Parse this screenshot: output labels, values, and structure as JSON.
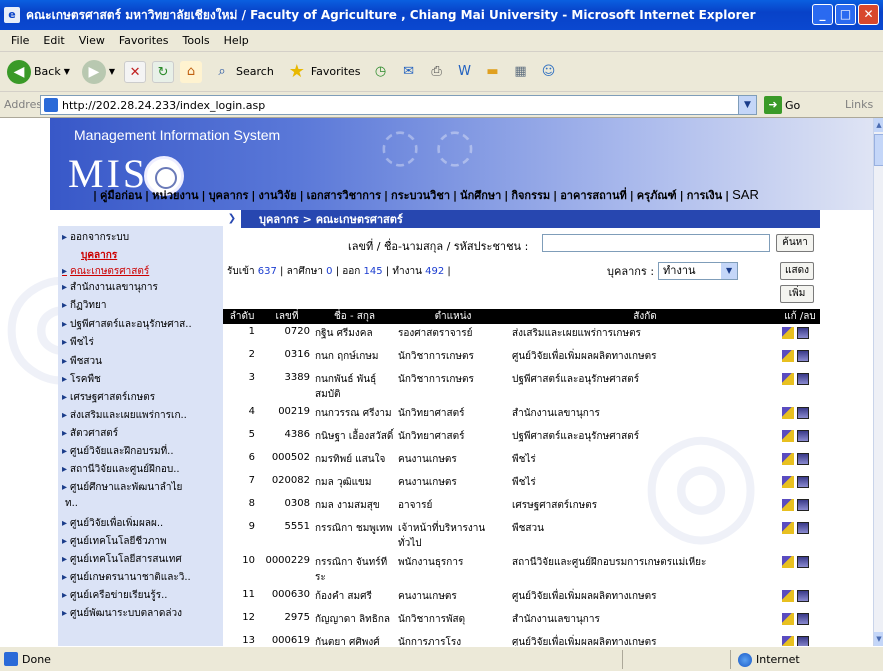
{
  "window": {
    "title": "คณะเกษตรศาสตร์ มหาวิทยาลัยเชียงใหม่ / Faculty of Agriculture , Chiang Mai University   - Microsoft Internet Explorer"
  },
  "menu": [
    "File",
    "Edit",
    "View",
    "Favorites",
    "Tools",
    "Help"
  ],
  "toolbar": {
    "back": "Back",
    "search": "Search",
    "favorites": "Favorites"
  },
  "address": {
    "label": "Address",
    "url": "http://202.28.24.233/index_login.asp",
    "go": "Go",
    "links": "Links"
  },
  "banner": {
    "title": "Management Information System",
    "logo_text": "MIS",
    "nav": [
      "คู่มือก่อน",
      "หน่วยงาน",
      "บุคลากร",
      "งานวิจัย",
      "เอกสารวิชาการ",
      "กระบวนวิชา",
      "นักศึกษา",
      "กิจกรรม",
      "อาคารสถานที่",
      "ครุภัณฑ์",
      "การเงิน",
      "SAR"
    ]
  },
  "sidebar": {
    "logout": "ออกจากระบบ",
    "header": "บุคลากร",
    "items": [
      "คณะเกษตรศาสตร์",
      "สำนักงานเลขานุการ",
      "กีฏวิทยา",
      "ปฐพีศาสตร์และอนุรักษศาส..",
      "พืชไร่",
      "พืชสวน",
      "โรคพืช",
      "เศรษฐศาสตร์เกษตร",
      "ส่งเสริมและเผยแพร่การเก..",
      "สัตวศาสตร์",
      "ศูนย์วิจัยและฝึกอบรมที่..",
      "สถานีวิจัยและศูนย์ฝึกอบ..",
      "ศูนย์ศึกษาและพัฒนาลำไย",
      "ศูนย์วิจัยเพื่อเพิ่มผลผ..",
      "ศูนย์เทคโนโลยีชีวภาพ",
      "ศูนย์เทคโนโลยีสารสนเทศ",
      "ศูนย์เกษตรนานาชาติและวิ..",
      "ศูนย์เครือข่ายเรียนรู้ร..",
      "ศูนย์พัฒนาระบบตลาดล่วง"
    ],
    "item_cont": "ท.."
  },
  "main": {
    "breadcrumb": "บุคลากร > คณะเกษตรศาสตร์",
    "search_label": "เลขที่ / ชื่อ-นามสกุล / รหัสประชาชน :",
    "search_value": "",
    "search_btn": "ค้นหา",
    "show_btn": "แสดง",
    "add_btn": "เพิ่ม",
    "counts": {
      "in_label": "รับเข้า",
      "in": "637",
      "leave_label": "ลาศึกษา",
      "leave": "0",
      "out_label": "ออก",
      "out": "145",
      "work_label": "ทำงาน",
      "work": "492"
    },
    "filter_label": "บุคลากร :",
    "filter_value": "ทำงาน",
    "columns": [
      "ลำดับ",
      "เลขที่",
      "ชื่อ - สกุล",
      "ตำแหน่ง",
      "สังกัด",
      "แก้ /ลบ"
    ],
    "rows": [
      [
        "1",
        "0720",
        "กฐิน ศรีมงคล",
        "รองศาสตราจารย์",
        "ส่งเสริมและเผยแพร่การเกษตร"
      ],
      [
        "2",
        "0316",
        "กนก ฤกษ์เกษม",
        "นักวิชาการเกษตร",
        "ศูนย์วิจัยเพื่อเพิ่มผลผลิตทางเกษตร"
      ],
      [
        "3",
        "3389",
        "กนกพันธ์ พันธุ์สมบัติ",
        "นักวิชาการเกษตร",
        "ปฐพีศาสตร์และอนุรักษศาสตร์"
      ],
      [
        "4",
        "00219",
        "กนกวรรณ ศรีงาม",
        "นักวิทยาศาสตร์",
        "สำนักงานเลขานุการ"
      ],
      [
        "5",
        "4386",
        "กนิษฐา เอื้องสวัสดิ์",
        "นักวิทยาศาสตร์",
        "ปฐพีศาสตร์และอนุรักษศาสตร์"
      ],
      [
        "6",
        "000502",
        "กมรทิพย์ แสนใจ",
        "คนงานเกษตร",
        "พืชไร่"
      ],
      [
        "7",
        "020082",
        "กมล วุฒิแขม",
        "คนงานเกษตร",
        "พืชไร่"
      ],
      [
        "8",
        "0308",
        "กมล งามสมสุข",
        "อาจารย์",
        "เศรษฐศาสตร์เกษตร"
      ],
      [
        "9",
        "5551",
        "กรรณิกา ชมพูเทพ",
        "เจ้าหน้าที่บริหารงานทั่วไป",
        "พืชสวน"
      ],
      [
        "10",
        "0000229",
        "กรรณิกา จันทร์ทีระ",
        "พนักงานธุรการ",
        "สถานีวิจัยและศูนย์ฝึกอบรมการเกษตรแม่เหียะ"
      ],
      [
        "11",
        "000630",
        "ก้องคำ สมศรี",
        "คนงานเกษตร",
        "ศูนย์วิจัยเพื่อเพิ่มผลผลิตทางเกษตร"
      ],
      [
        "12",
        "2975",
        "กัญญาดา ลิทธิกล",
        "นักวิชาการพัสดุ",
        "สำนักงานเลขานุการ"
      ],
      [
        "13",
        "000619",
        "กันตยา ศศิพงศ์พนา",
        "นักการภารโรง",
        "ศูนย์วิจัยเพื่อเพิ่มผลผลิตทางเกษตร"
      ]
    ]
  },
  "status": {
    "left": "Done",
    "zone": "Internet"
  }
}
